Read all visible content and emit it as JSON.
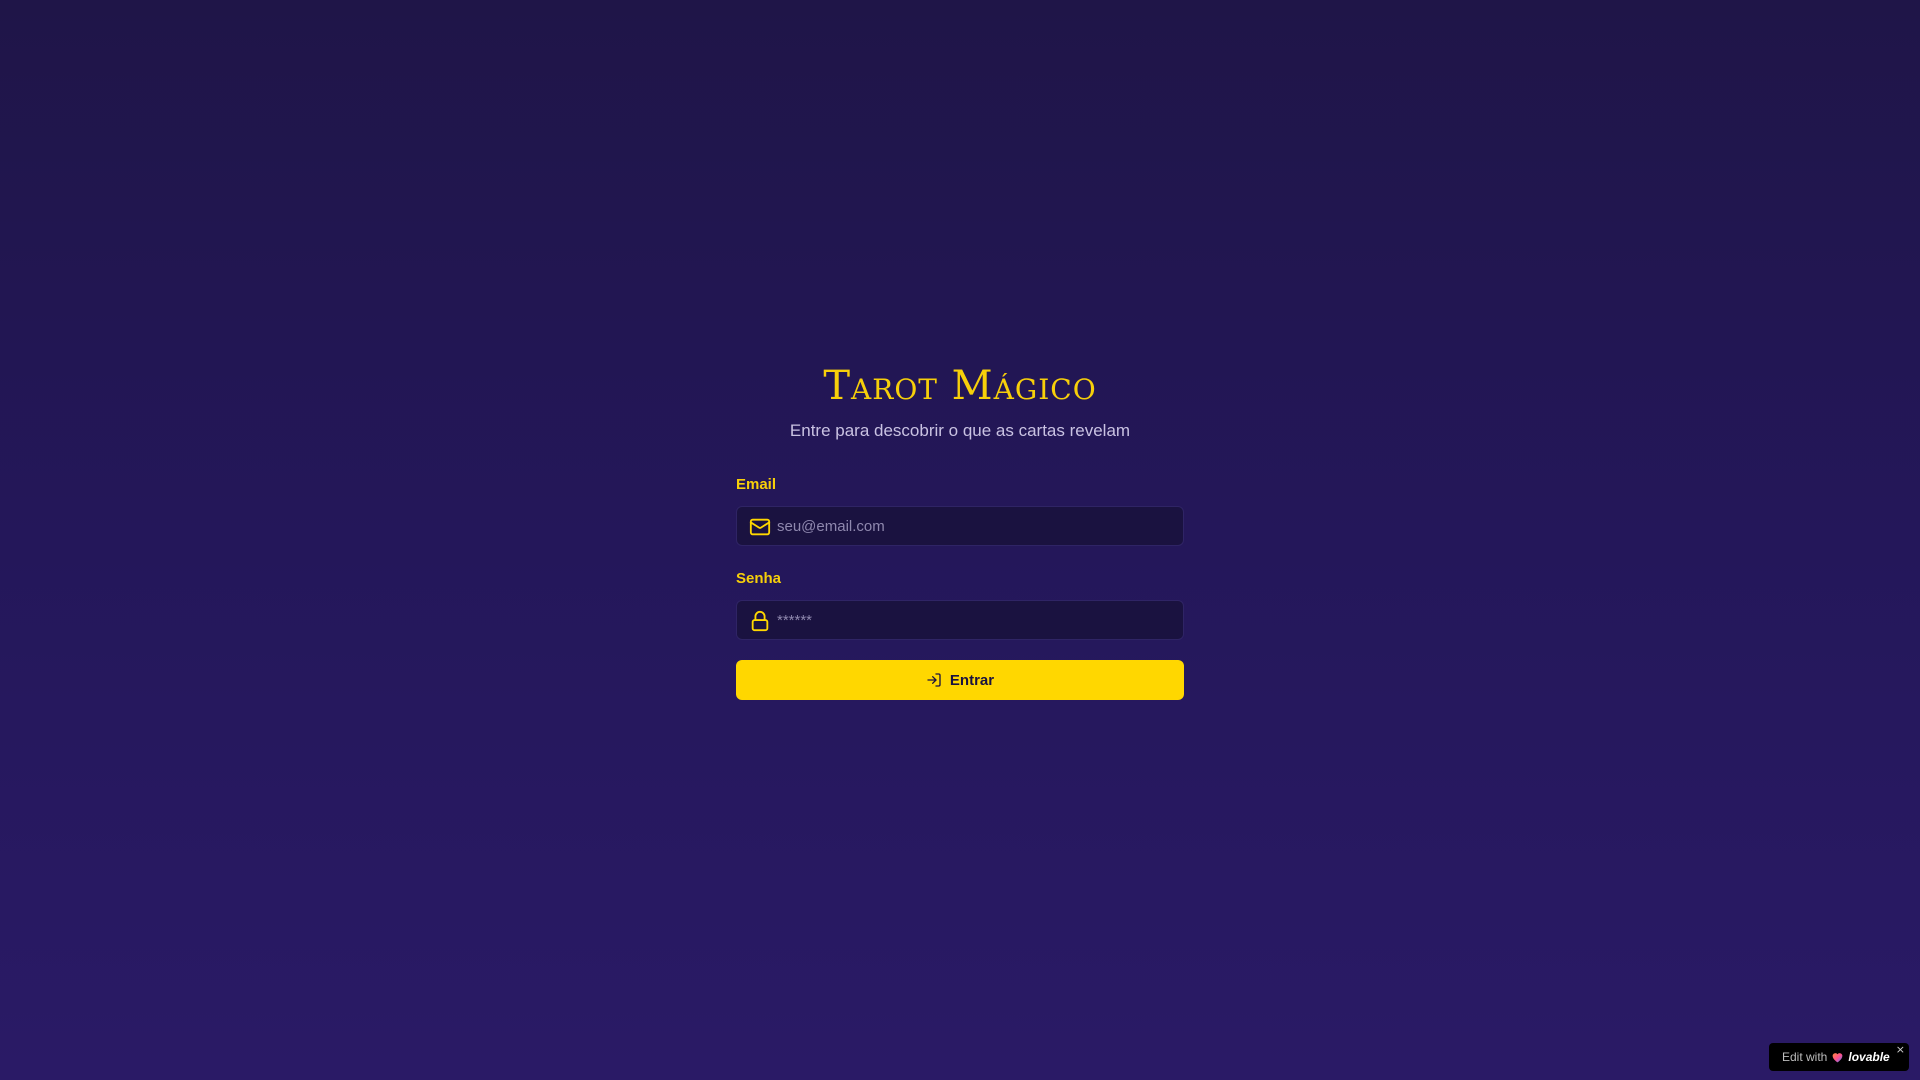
{
  "app": {
    "title": "Tarot Mágico",
    "subtitle": "Entre para descobrir o que as cartas revelam"
  },
  "form": {
    "email": {
      "label": "Email",
      "placeholder": "seu@email.com",
      "value": "",
      "icon": "mail-icon"
    },
    "password": {
      "label": "Senha",
      "placeholder": "******",
      "value": "",
      "icon": "lock-icon"
    },
    "submit": {
      "label": "Entrar",
      "icon": "log-in-icon"
    }
  },
  "badge": {
    "prefix": "Edit with",
    "brand": "lovable",
    "close": "×"
  },
  "colors": {
    "accent": "#ffd700",
    "label": "#f7cf0a",
    "background_top": "#1f1548",
    "background_bottom": "#2a1a66",
    "input_bg": "#1a1240"
  }
}
